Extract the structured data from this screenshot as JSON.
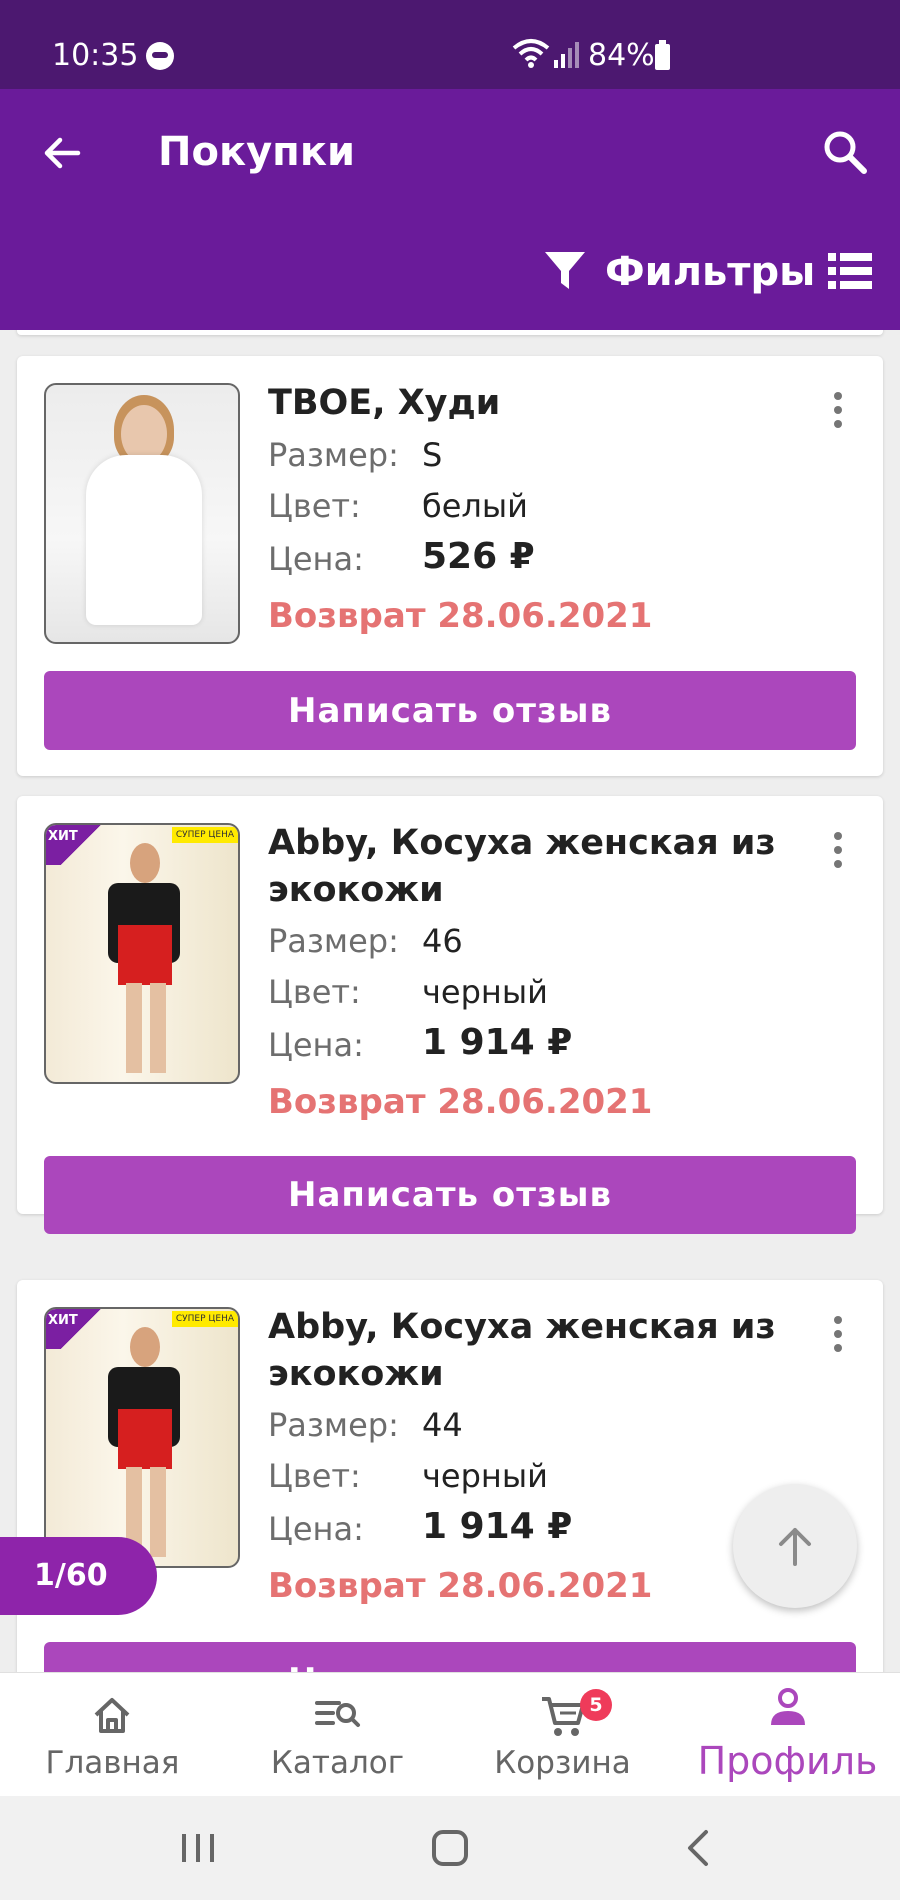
{
  "status_bar": {
    "time": "10:35",
    "battery": "84%"
  },
  "header": {
    "title": "Покупки",
    "filters_label": "Фильтры"
  },
  "labels": {
    "size": "Размер:",
    "color": "Цвет:",
    "price": "Цена:",
    "review_button": "Написать отзыв"
  },
  "purchases": [
    {
      "title": "ТВОЕ, Худи",
      "size": "S",
      "color": "белый",
      "price": "526 ₽",
      "status": "Возврат 28.06.2021"
    },
    {
      "title": "Abby, Косуха женская из экокожи",
      "size": "46",
      "color": "черный",
      "price": "1 914 ₽",
      "status": "Возврат 28.06.2021",
      "badge_hit": "ХИТ",
      "badge_super": "СУПЕР ЦЕНА"
    },
    {
      "title": "Abby, Косуха женская из экокожи",
      "size": "44",
      "color": "черный",
      "price": "1 914 ₽",
      "status": "Возврат 28.06.2021",
      "badge_hit": "ХИТ",
      "badge_super": "СУПЕР ЦЕНА"
    }
  ],
  "pagination": {
    "counter": "1/60"
  },
  "bottom_nav": {
    "items": [
      {
        "label": "Главная",
        "icon": "home-icon"
      },
      {
        "label": "Каталог",
        "icon": "catalog-icon"
      },
      {
        "label": "Корзина",
        "icon": "cart-icon",
        "badge": "5"
      },
      {
        "label": "Профиль",
        "icon": "profile-icon",
        "active": true
      }
    ]
  },
  "colors": {
    "status_bar": "#4c1870",
    "app_bar": "#6a1b9a",
    "accent": "#ab47bc",
    "return_text": "#e57373",
    "cart_badge": "#ef3b5a"
  }
}
